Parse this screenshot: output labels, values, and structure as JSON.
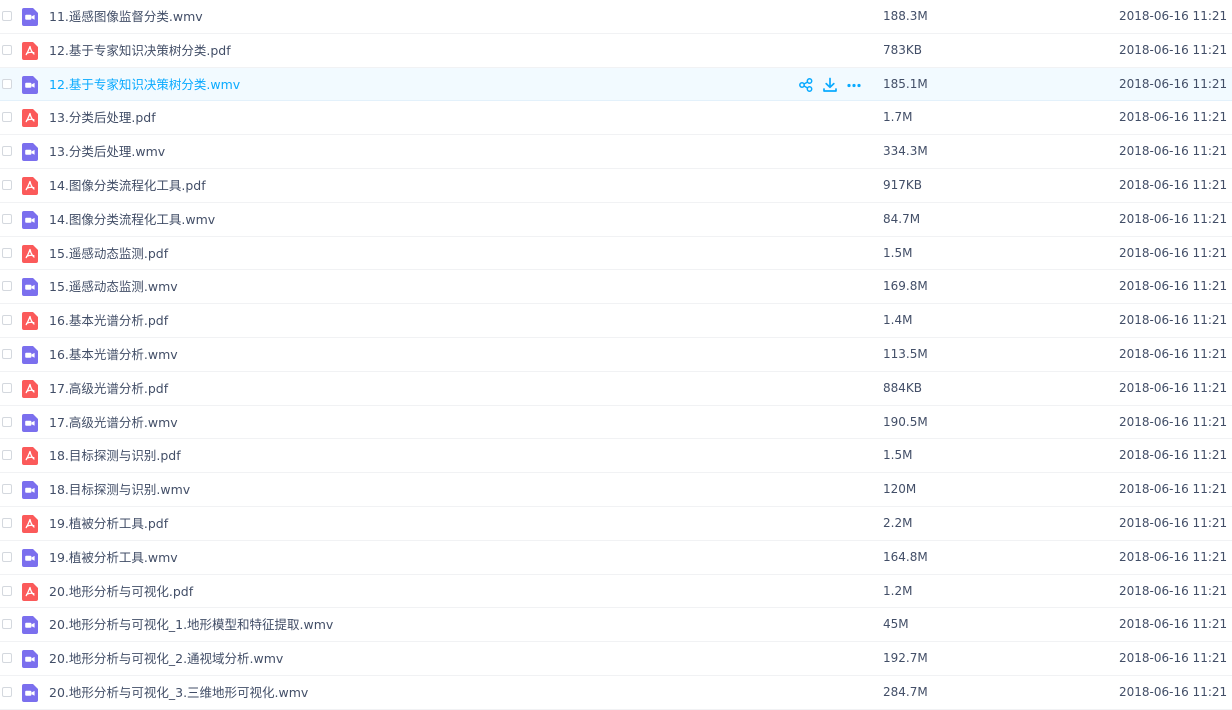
{
  "files": [
    {
      "name": "11.遥感图像监督分类.wmv",
      "size": "188.3M",
      "date": "2018-06-16 11:21",
      "type": "video",
      "icon": "video-file-icon"
    },
    {
      "name": "12.基于专家知识决策树分类.pdf",
      "size": "783KB",
      "date": "2018-06-16 11:21",
      "type": "pdf",
      "icon": "pdf-file-icon"
    },
    {
      "name": "12.基于专家知识决策树分类.wmv",
      "size": "185.1M",
      "date": "2018-06-16 11:21",
      "type": "video",
      "icon": "video-file-icon",
      "hovered": true
    },
    {
      "name": "13.分类后处理.pdf",
      "size": "1.7M",
      "date": "2018-06-16 11:21",
      "type": "pdf",
      "icon": "pdf-file-icon"
    },
    {
      "name": "13.分类后处理.wmv",
      "size": "334.3M",
      "date": "2018-06-16 11:21",
      "type": "video",
      "icon": "video-file-icon"
    },
    {
      "name": "14.图像分类流程化工具.pdf",
      "size": "917KB",
      "date": "2018-06-16 11:21",
      "type": "pdf",
      "icon": "pdf-file-icon"
    },
    {
      "name": "14.图像分类流程化工具.wmv",
      "size": "84.7M",
      "date": "2018-06-16 11:21",
      "type": "video",
      "icon": "video-file-icon"
    },
    {
      "name": "15.遥感动态监测.pdf",
      "size": "1.5M",
      "date": "2018-06-16 11:21",
      "type": "pdf",
      "icon": "pdf-file-icon"
    },
    {
      "name": "15.遥感动态监测.wmv",
      "size": "169.8M",
      "date": "2018-06-16 11:21",
      "type": "video",
      "icon": "video-file-icon"
    },
    {
      "name": "16.基本光谱分析.pdf",
      "size": "1.4M",
      "date": "2018-06-16 11:21",
      "type": "pdf",
      "icon": "pdf-file-icon"
    },
    {
      "name": "16.基本光谱分析.wmv",
      "size": "113.5M",
      "date": "2018-06-16 11:21",
      "type": "video",
      "icon": "video-file-icon"
    },
    {
      "name": "17.高级光谱分析.pdf",
      "size": "884KB",
      "date": "2018-06-16 11:21",
      "type": "pdf",
      "icon": "pdf-file-icon"
    },
    {
      "name": "17.高级光谱分析.wmv",
      "size": "190.5M",
      "date": "2018-06-16 11:21",
      "type": "video",
      "icon": "video-file-icon"
    },
    {
      "name": "18.目标探测与识别.pdf",
      "size": "1.5M",
      "date": "2018-06-16 11:21",
      "type": "pdf",
      "icon": "pdf-file-icon"
    },
    {
      "name": "18.目标探测与识别.wmv",
      "size": "120M",
      "date": "2018-06-16 11:21",
      "type": "video",
      "icon": "video-file-icon"
    },
    {
      "name": "19.植被分析工具.pdf",
      "size": "2.2M",
      "date": "2018-06-16 11:21",
      "type": "pdf",
      "icon": "pdf-file-icon"
    },
    {
      "name": "19.植被分析工具.wmv",
      "size": "164.8M",
      "date": "2018-06-16 11:21",
      "type": "video",
      "icon": "video-file-icon"
    },
    {
      "name": "20.地形分析与可视化.pdf",
      "size": "1.2M",
      "date": "2018-06-16 11:21",
      "type": "pdf",
      "icon": "pdf-file-icon"
    },
    {
      "name": "20.地形分析与可视化_1.地形模型和特征提取.wmv",
      "size": "45M",
      "date": "2018-06-16 11:21",
      "type": "video",
      "icon": "video-file-icon"
    },
    {
      "name": "20.地形分析与可视化_2.通视域分析.wmv",
      "size": "192.7M",
      "date": "2018-06-16 11:21",
      "type": "video",
      "icon": "video-file-icon"
    },
    {
      "name": "20.地形分析与可视化_3.三维地形可视化.wmv",
      "size": "284.7M",
      "date": "2018-06-16 11:21",
      "type": "video",
      "icon": "video-file-icon"
    }
  ],
  "row_actions": [
    {
      "icon": "share-icon"
    },
    {
      "icon": "download-icon"
    },
    {
      "icon": "more-icon"
    }
  ],
  "colors": {
    "video_icon": "#7b6fee",
    "pdf_icon": "#fb5a5a",
    "text": "#424e67",
    "hover_text": "#09aaff",
    "hover_row": "#f2faff",
    "action_icon": "#09aaff"
  }
}
